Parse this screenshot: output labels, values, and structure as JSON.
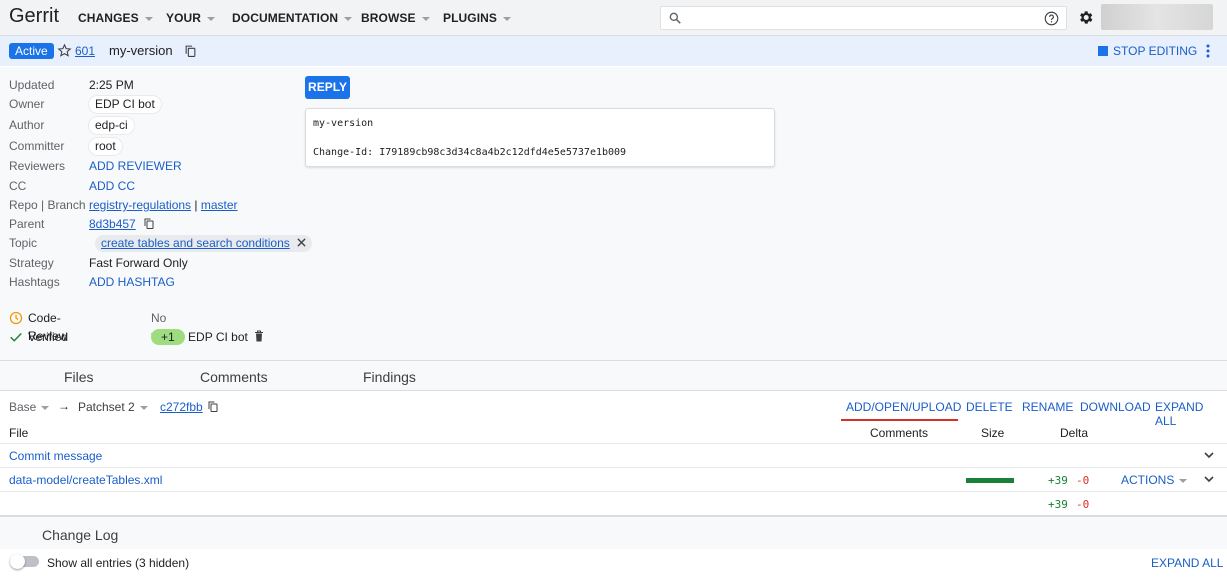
{
  "topbar": {
    "logo": "Gerrit",
    "nav": [
      "CHANGES",
      "YOUR",
      "DOCUMENTATION",
      "BROWSE",
      "PLUGINS"
    ],
    "search_placeholder": ""
  },
  "change": {
    "status": "Active",
    "number": "601",
    "subject": "my-version",
    "stop_editing": "STOP EDITING"
  },
  "meta": {
    "updated_label": "Updated",
    "updated": "2:25 PM",
    "owner_label": "Owner",
    "owner": "EDP CI bot",
    "author_label": "Author",
    "author": "edp-ci",
    "committer_label": "Committer",
    "committer": "root",
    "reviewers_label": "Reviewers",
    "reviewers": "ADD REVIEWER",
    "cc_label": "CC",
    "cc": "ADD CC",
    "repo_label": "Repo | Branch",
    "repo": "registry-regulations",
    "sep": "|",
    "branch": "master",
    "parent_label": "Parent",
    "parent": "8d3b457",
    "topic_label": "Topic",
    "topic": "create tables and search conditions",
    "strategy_label": "Strategy",
    "strategy": "Fast Forward Only",
    "hashtags_label": "Hashtags",
    "hashtags": "ADD HASHTAG"
  },
  "reply": "REPLY",
  "commit_msg": {
    "line1": "my-version",
    "line2": "Change-Id: I79189cb98c3d34c8a4b2c12dfd4e5e5737e1b009"
  },
  "labels": {
    "code_review": "Code-Review",
    "code_review_val": "No votes.",
    "verified": "Verified",
    "verified_vote": "+1",
    "verified_by": "EDP CI bot"
  },
  "tabs": [
    "Files",
    "Comments",
    "Findings"
  ],
  "files_toolbar": {
    "base": "Base",
    "arrow": "→",
    "patchset": "Patchset 2",
    "commit": "c272fbb",
    "buttons": [
      "ADD/OPEN/UPLOAD",
      "DELETE",
      "RENAME",
      "DOWNLOAD",
      "EXPAND ALL"
    ]
  },
  "files_header": {
    "file": "File",
    "comments": "Comments",
    "size": "Size",
    "delta": "Delta"
  },
  "files": [
    {
      "name": "Commit message"
    },
    {
      "name": "data-model/createTables.xml",
      "added": "+39",
      "removed": "-0",
      "actions": "ACTIONS"
    }
  ],
  "totals": {
    "added": "+39",
    "removed": "-0"
  },
  "changelog": {
    "title": "Change Log",
    "show_all": "Show all entries (3 hidden)",
    "expand_all": "EXPAND ALL"
  }
}
